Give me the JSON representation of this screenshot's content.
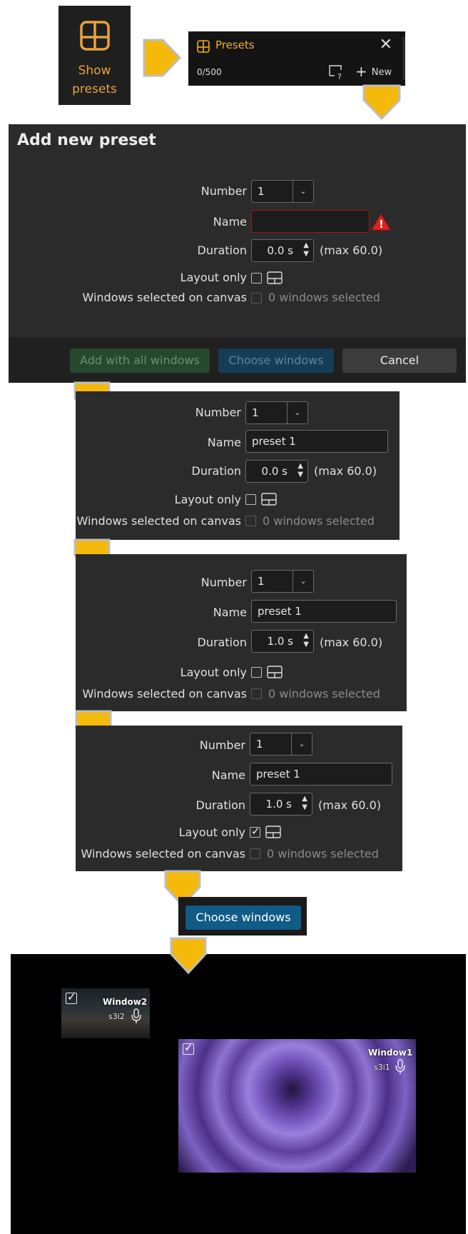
{
  "show_presets": {
    "label_line1": "Show",
    "label_line2": "presets",
    "accent": "#e8a33c",
    "icon": "layout-grid-icon"
  },
  "presets_bar": {
    "title": "Presets",
    "close_glyph": "✕",
    "count": "0/500",
    "new_label": "New",
    "help_icon": "select-help-icon",
    "title_color": "#f2b01e"
  },
  "dialog": {
    "title": "Add new preset",
    "number_label": "Number",
    "number_value": "1",
    "name_label": "Name",
    "name_value": "",
    "duration_label": "Duration",
    "duration_value": "0.0 s",
    "duration_max": "(max 60.0)",
    "layout_only_label": "Layout only",
    "layout_only_checked": false,
    "windows_label": "Windows selected on canvas",
    "windows_value": "0 windows selected",
    "add_all_label": "Add with all windows",
    "choose_label": "Choose windows",
    "cancel_label": "Cancel",
    "error_icon": "warning-triangle-icon"
  },
  "step2": {
    "number_label": "Number",
    "number_value": "1",
    "name_label": "Name",
    "name_value": "preset 1",
    "duration_label": "Duration",
    "duration_value": "0.0 s",
    "duration_max": "(max 60.0)",
    "layout_only_label": "Layout only",
    "windows_label": "Windows selected on canvas",
    "windows_value": "0 windows selected"
  },
  "step3": {
    "number_label": "Number",
    "number_value": "1",
    "name_label": "Name",
    "name_value": "preset 1",
    "duration_label": "Duration",
    "duration_value": "1.0 s",
    "duration_max": "(max 60.0)",
    "layout_only_label": "Layout only",
    "windows_label": "Windows selected on canvas",
    "windows_value": "0 windows selected"
  },
  "step4": {
    "number_label": "Number",
    "number_value": "1",
    "name_label": "Name",
    "name_value": "preset 1",
    "duration_label": "Duration",
    "duration_value": "1.0 s",
    "duration_max": "(max 60.0)",
    "layout_only_label": "Layout only",
    "layout_only_checked": true,
    "windows_label": "Windows selected on canvas",
    "windows_value": "0 windows selected"
  },
  "choose_windows_button": {
    "label": "Choose windows",
    "color": "#0f5c86"
  },
  "canvas": {
    "windows": [
      {
        "name": "Window2",
        "source": "s3i2",
        "checked": true
      },
      {
        "name": "Window1",
        "source": "s3i1",
        "checked": true
      }
    ]
  },
  "arrow_color": "#f5b90a"
}
